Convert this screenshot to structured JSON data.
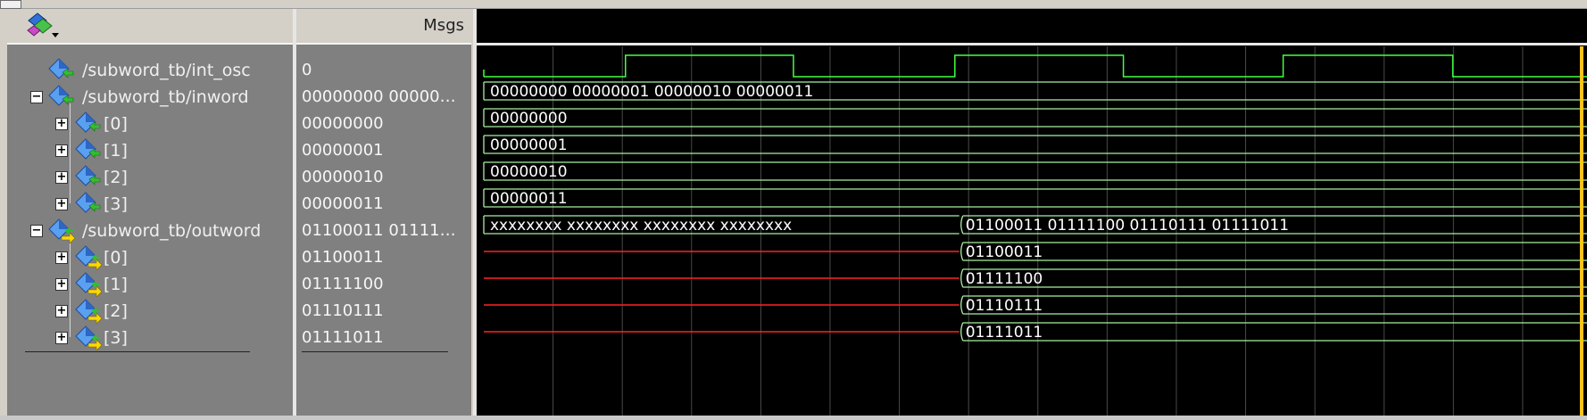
{
  "header": {
    "toolbar_icon": "wave-display-icon",
    "dropdown_icon": "dropdown-arrow-icon",
    "values_column_label": "Msgs"
  },
  "colors": {
    "bus": "#a8f0a0",
    "clock": "#44ff44",
    "unknown": "#ff2222",
    "grid": "#4a4a4a",
    "cursor": "#ffc21a",
    "background": "#000000"
  },
  "signals": [
    {
      "name": "/subword_tb/int_osc",
      "value": "0",
      "expander": "",
      "kind": "input",
      "level": 0,
      "wave": {
        "type": "clock",
        "initial": 0,
        "edges": [
          0.1295,
          0.283,
          0.4305,
          0.5845,
          0.7305,
          0.8855
        ]
      }
    },
    {
      "name": "/subword_tb/inword",
      "value": "00000000 00000…",
      "expander": "−",
      "kind": "input",
      "level": 0,
      "wave": {
        "type": "bus",
        "segments": [
          {
            "from": 0,
            "to": 1,
            "label": "00000000 00000001 00000010 00000011"
          }
        ]
      }
    },
    {
      "name": "[0]",
      "value": "00000000",
      "expander": "+",
      "kind": "input",
      "level": 1,
      "wave": {
        "type": "bus",
        "segments": [
          {
            "from": 0,
            "to": 1,
            "label": "00000000"
          }
        ]
      }
    },
    {
      "name": "[1]",
      "value": "00000001",
      "expander": "+",
      "kind": "input",
      "level": 1,
      "wave": {
        "type": "bus",
        "segments": [
          {
            "from": 0,
            "to": 1,
            "label": "00000001"
          }
        ]
      }
    },
    {
      "name": "[2]",
      "value": "00000010",
      "expander": "+",
      "kind": "input",
      "level": 1,
      "wave": {
        "type": "bus",
        "segments": [
          {
            "from": 0,
            "to": 1,
            "label": "00000010"
          }
        ]
      }
    },
    {
      "name": "[3]",
      "value": "00000011",
      "expander": "+",
      "kind": "input",
      "level": 1,
      "wave": {
        "type": "bus",
        "segments": [
          {
            "from": 0,
            "to": 1,
            "label": "00000011"
          }
        ]
      }
    },
    {
      "name": "/subword_tb/outword",
      "value": "01100011 01111…",
      "expander": "−",
      "kind": "output",
      "level": 0,
      "wave": {
        "type": "bus",
        "segments": [
          {
            "from": 0,
            "to": 0.4345,
            "label": "xxxxxxxx xxxxxxxx xxxxxxxx xxxxxxxx"
          },
          {
            "from": 0.4345,
            "to": 1,
            "label": "01100011 01111100 01110111 01111011"
          }
        ]
      }
    },
    {
      "name": "[0]",
      "value": "01100011",
      "expander": "+",
      "kind": "output",
      "level": 1,
      "wave": {
        "type": "bus",
        "segments": [
          {
            "from": 0,
            "to": 0.4345,
            "label": "",
            "unknown": true
          },
          {
            "from": 0.4345,
            "to": 1,
            "label": "01100011"
          }
        ]
      }
    },
    {
      "name": "[1]",
      "value": "01111100",
      "expander": "+",
      "kind": "output",
      "level": 1,
      "wave": {
        "type": "bus",
        "segments": [
          {
            "from": 0,
            "to": 0.4345,
            "label": "",
            "unknown": true
          },
          {
            "from": 0.4345,
            "to": 1,
            "label": "01111100"
          }
        ]
      }
    },
    {
      "name": "[2]",
      "value": "01110111",
      "expander": "+",
      "kind": "output",
      "level": 1,
      "wave": {
        "type": "bus",
        "segments": [
          {
            "from": 0,
            "to": 0.4345,
            "label": "",
            "unknown": true
          },
          {
            "from": 0.4345,
            "to": 1,
            "label": "01110111"
          }
        ]
      }
    },
    {
      "name": "[3]",
      "value": "01111011",
      "expander": "+",
      "kind": "output",
      "level": 1,
      "wave": {
        "type": "bus",
        "segments": [
          {
            "from": 0,
            "to": 0.4345,
            "label": "",
            "unknown": true
          },
          {
            "from": 0.4345,
            "to": 1,
            "label": "01111011"
          }
        ]
      }
    }
  ]
}
